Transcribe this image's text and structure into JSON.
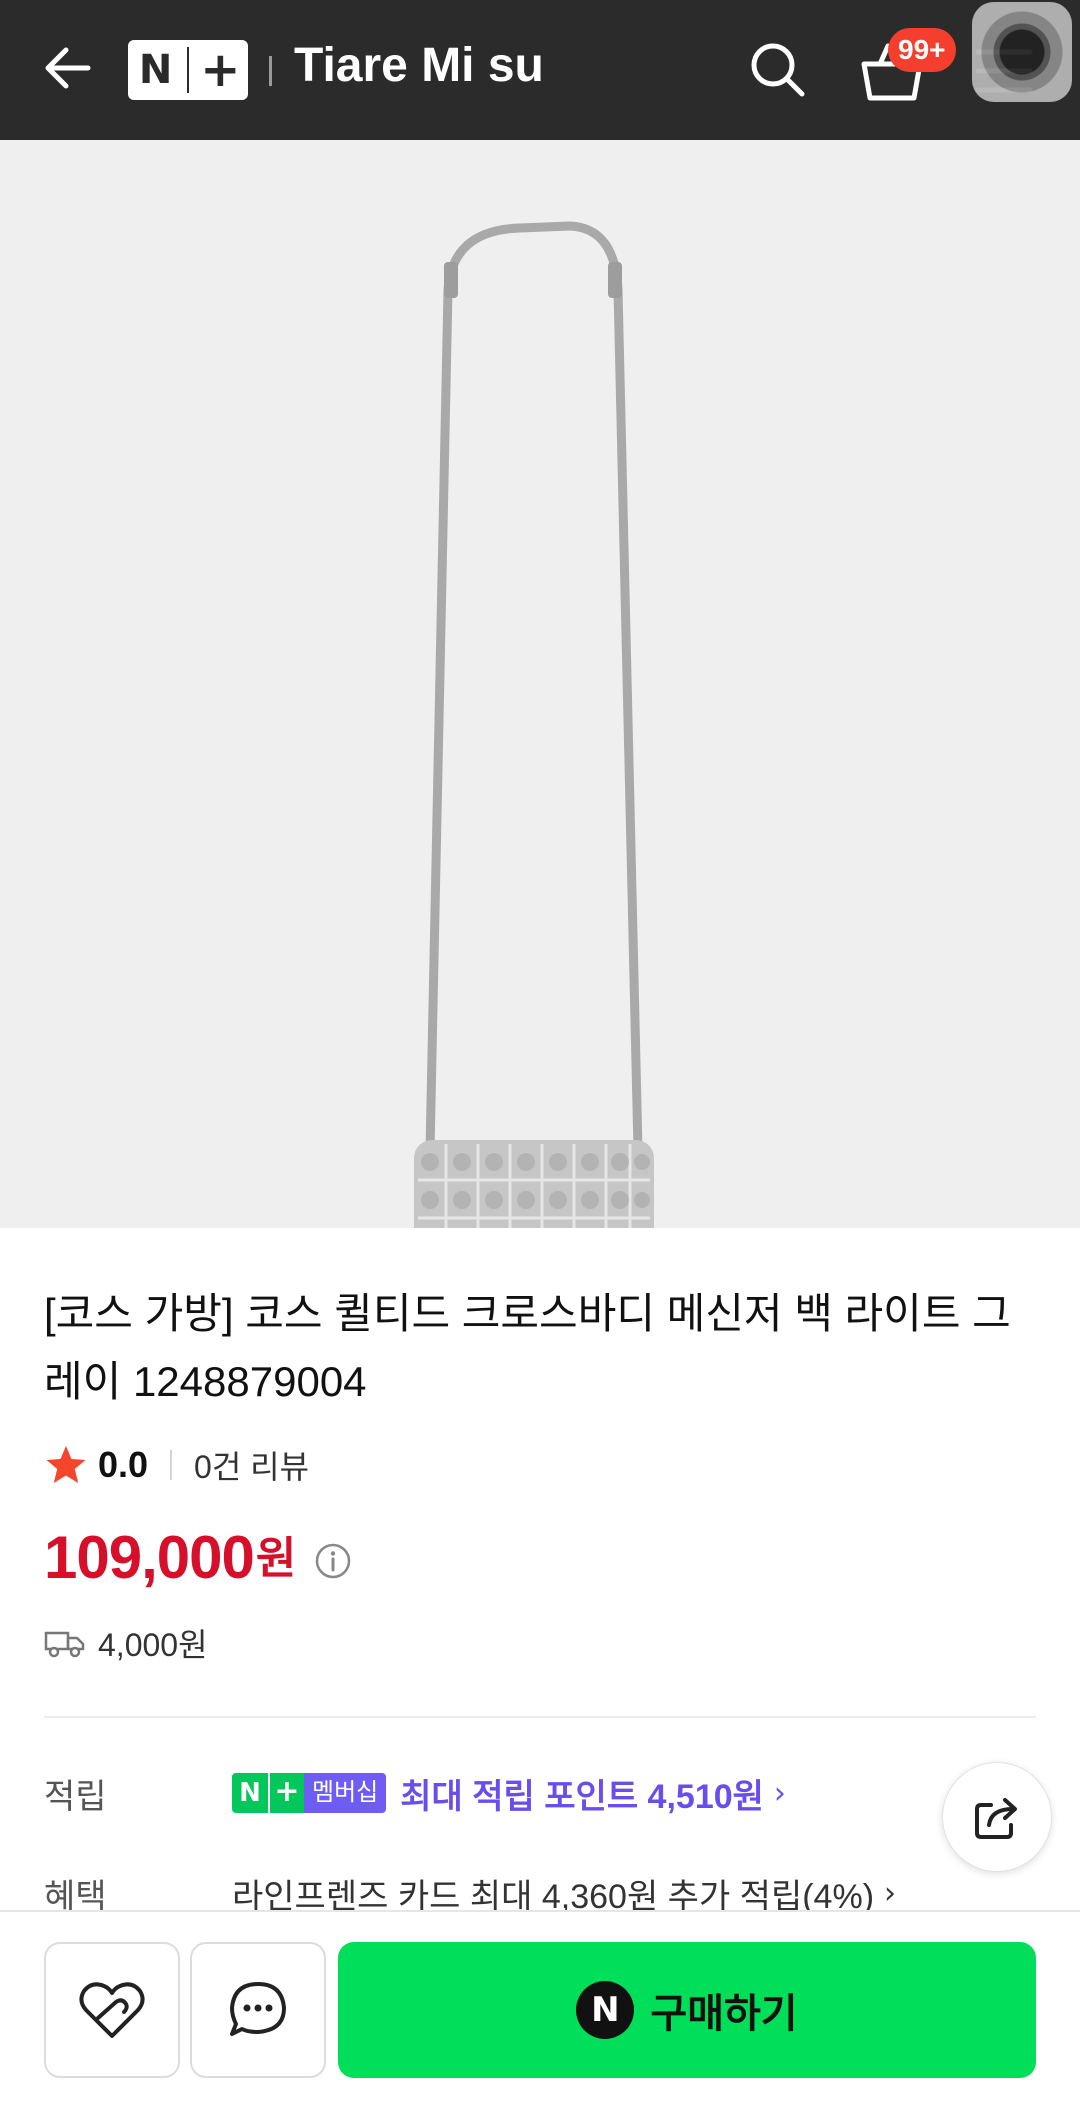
{
  "header": {
    "logo_n": "N",
    "logo_plus": "+",
    "store_name": "Tiare Mi su",
    "cart_badge": "99+"
  },
  "icons": {
    "back": "arrow-left-icon",
    "search": "search-icon",
    "cart": "cart-icon",
    "menu": "hamburger-menu-icon",
    "star": "star-icon",
    "info": "info-icon",
    "truck": "truck-icon",
    "share": "share-icon",
    "wish": "heart-icon",
    "talk": "chat-icon"
  },
  "product": {
    "title": "[코스 가방] 코스 퀼티드 크로스바디 메신저 백 라이트 그레이 1248879004",
    "rating": "0.0",
    "reviews": "0건 리뷰",
    "price": "109,000",
    "price_unit": "원",
    "shipping_fee": "4,000원"
  },
  "benefits": {
    "points_label": "적립",
    "badge_n": "N",
    "badge_plus": "+",
    "badge_membership": "멤버십",
    "points_text": "최대 적립 포인트 4,510원",
    "benefit_label": "혜택",
    "card_text": "라인프렌즈 카드 최대 4,360원 추가 적립(4%)"
  },
  "bottom": {
    "buy_n": "N",
    "buy_label": "구매하기"
  },
  "colors": {
    "topbar": "#2b2b2b",
    "price": "#d6102b",
    "points": "#6a4dea",
    "buy_button": "#00de5a",
    "badge": "#f43f2e",
    "star": "#f5452a"
  }
}
